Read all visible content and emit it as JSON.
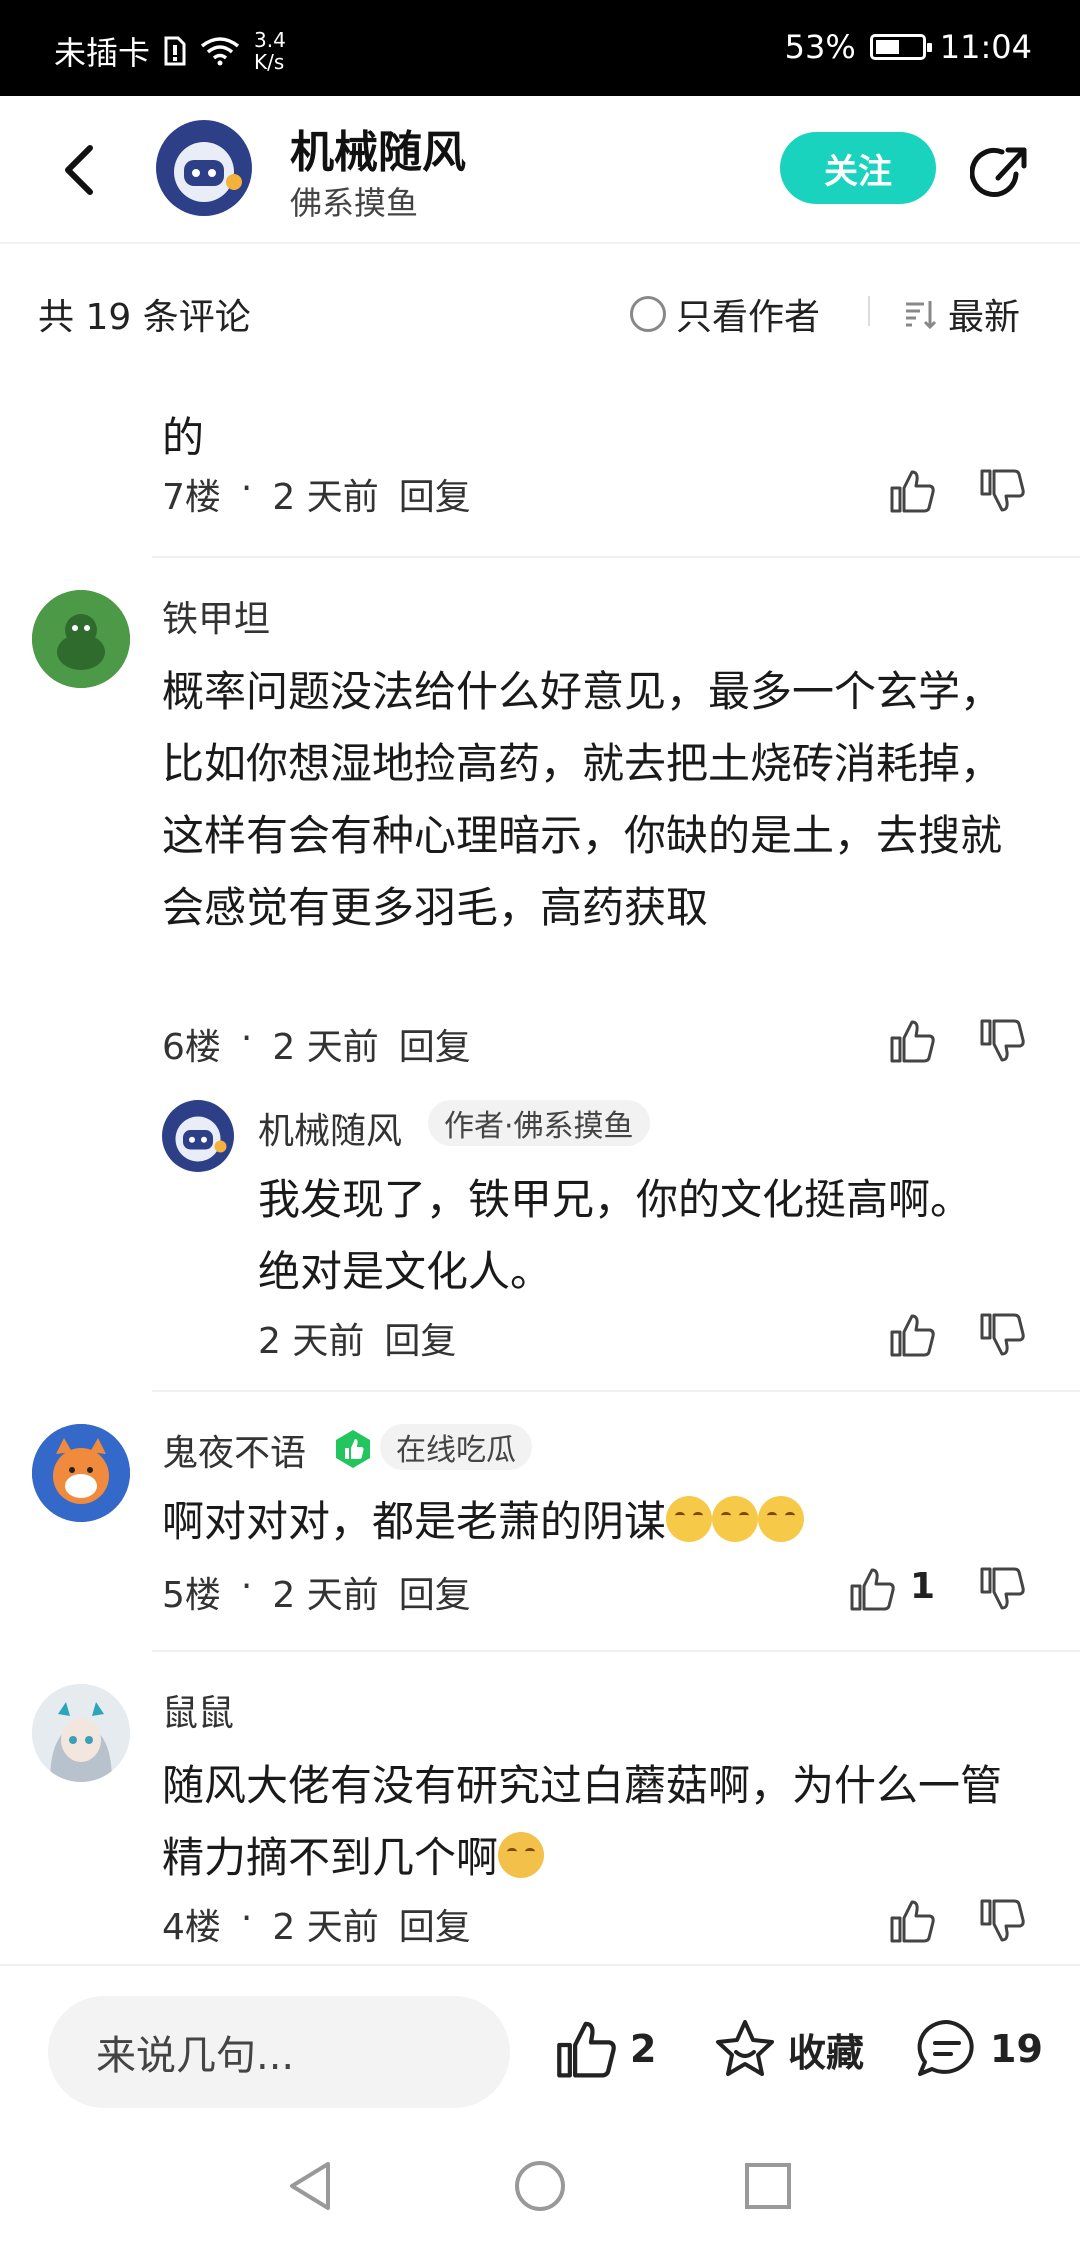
{
  "status_bar": {
    "carrier": "未插卡",
    "speed_value": "3.4",
    "speed_unit": "K/s",
    "battery": "53%",
    "battery_level": 0.53,
    "time": "11:04"
  },
  "header": {
    "title": "机械随风",
    "subtitle": "佛系摸鱼",
    "follow_label": "关注"
  },
  "sort_bar": {
    "count_text": "共 19 条评论",
    "author_only_label": "只看作者",
    "sort_label": "最新"
  },
  "comments": [
    {
      "text_tail": "的",
      "floor": "7楼",
      "time": "2 天前",
      "reply_label": "回复"
    },
    {
      "username": "铁甲坦",
      "text": "概率问题没法给什么好意见，最多一个玄学，比如你想湿地捡高药，就去把土烧砖消耗掉，这样有会有种心理暗示，你缺的是土，去搜就会感觉有更多羽毛，高药获取",
      "floor": "6楼",
      "time": "2 天前",
      "reply_label": "回复",
      "reply": {
        "username": "机械随风",
        "tag": "作者·佛系摸鱼",
        "text": "我发现了，铁甲兄，你的文化挺高啊。绝对是文化人。",
        "time": "2 天前",
        "reply_label": "回复"
      }
    },
    {
      "username": "鬼夜不语",
      "tag": "在线吃瓜",
      "text": "啊对对对，都是老萧的阴谋",
      "floor": "5楼",
      "time": "2 天前",
      "reply_label": "回复",
      "likes": "1"
    },
    {
      "username": "鼠鼠",
      "text": "随风大佬有没有研究过白蘑菇啊，为什么一管精力摘不到几个啊",
      "floor": "4楼",
      "time": "2 天前",
      "reply_label": "回复"
    }
  ],
  "bottom_bar": {
    "input_placeholder": "来说几句...",
    "like_count": "2",
    "favorite_label": "收藏",
    "comment_count": "19"
  },
  "colors": {
    "accent": "#19d3be",
    "header_avatar_bg": "#2d3f86"
  }
}
